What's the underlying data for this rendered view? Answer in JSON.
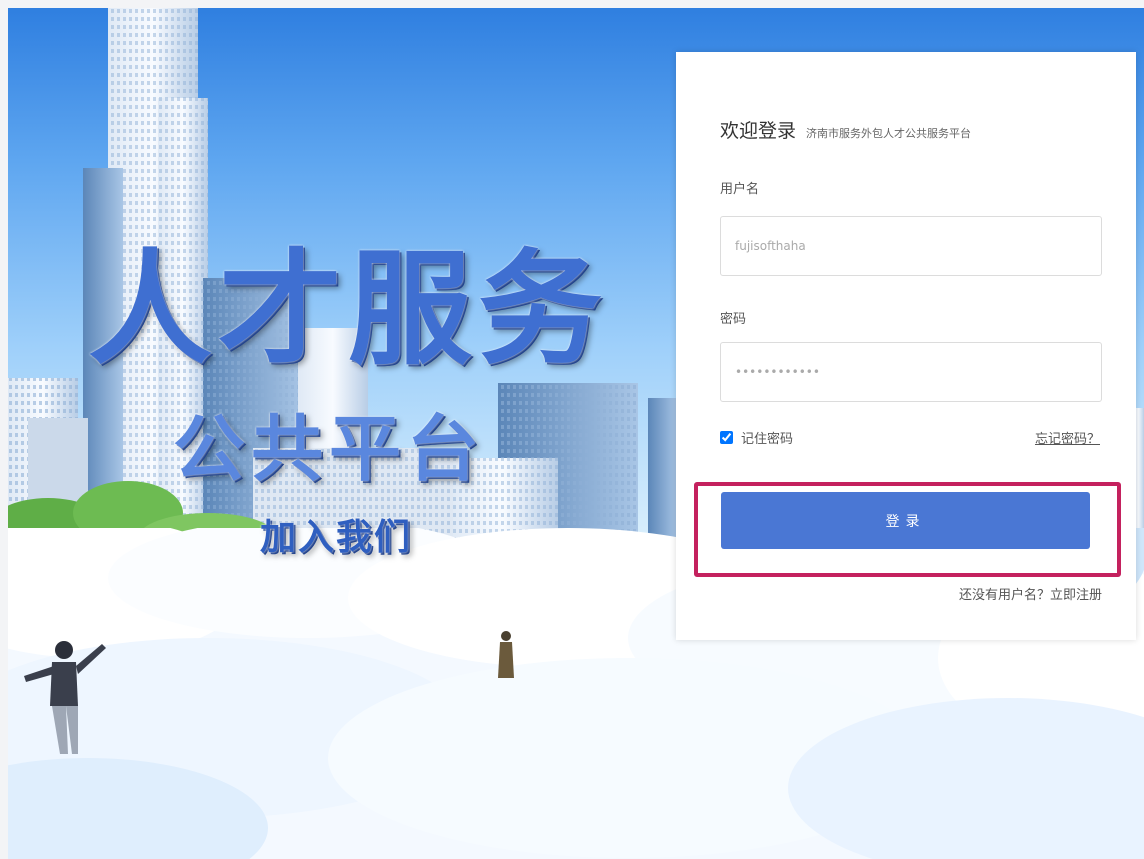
{
  "hero": {
    "title": "人才服务",
    "subtitle": "公共平台",
    "join": "加入我们"
  },
  "login": {
    "welcome_title": "欢迎登录",
    "welcome_subtitle": "济南市服务外包人才公共服务平台",
    "username_label": "用户名",
    "username_value": "fujisofthaha",
    "password_label": "密码",
    "password_value": "••••••••••••",
    "remember_label": "记住密码",
    "remember_checked": true,
    "forgot_label": "忘记密码？",
    "submit_label": "登录",
    "register_label": "还没有用户名？立即注册"
  },
  "colors": {
    "accent": "#4a77d4",
    "highlight": "#c4215e"
  }
}
